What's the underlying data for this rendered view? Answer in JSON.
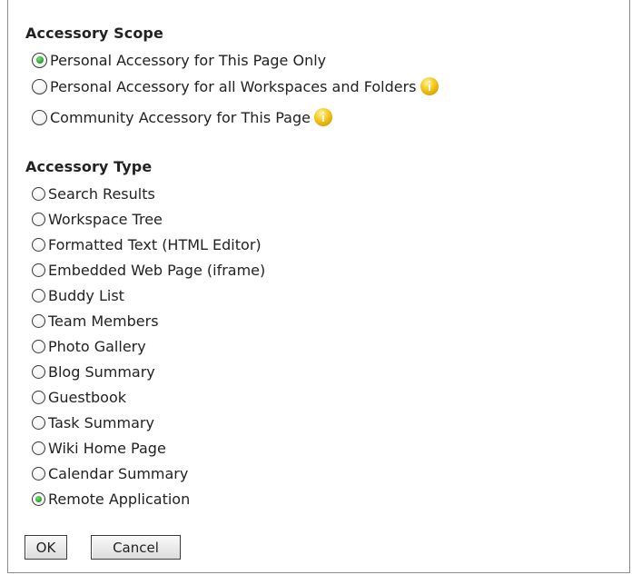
{
  "scope": {
    "title": "Accessory Scope",
    "options": [
      {
        "label": "Personal Accessory for This Page Only",
        "checked": true,
        "info": false
      },
      {
        "label": "Personal Accessory for all Workspaces and Folders",
        "checked": false,
        "info": true
      },
      {
        "label": "Community Accessory for This Page",
        "checked": false,
        "info": true
      }
    ]
  },
  "type": {
    "title": "Accessory Type",
    "options": [
      {
        "label": "Search Results",
        "checked": false
      },
      {
        "label": "Workspace Tree",
        "checked": false
      },
      {
        "label": "Formatted Text (HTML Editor)",
        "checked": false
      },
      {
        "label": "Embedded Web Page (iframe)",
        "checked": false
      },
      {
        "label": "Buddy List",
        "checked": false
      },
      {
        "label": "Team Members",
        "checked": false
      },
      {
        "label": "Photo Gallery",
        "checked": false
      },
      {
        "label": "Blog Summary",
        "checked": false
      },
      {
        "label": "Guestbook",
        "checked": false
      },
      {
        "label": "Task Summary",
        "checked": false
      },
      {
        "label": "Wiki Home Page",
        "checked": false
      },
      {
        "label": "Calendar Summary",
        "checked": false
      },
      {
        "label": "Remote Application",
        "checked": true
      }
    ]
  },
  "buttons": {
    "ok": "OK",
    "cancel": "Cancel"
  },
  "icons": {
    "info": "info-icon",
    "radio": "radio-button"
  },
  "colors": {
    "radio_check": "#2ea62e",
    "info_icon": "#f5c518",
    "border": "#8c8c8c"
  }
}
